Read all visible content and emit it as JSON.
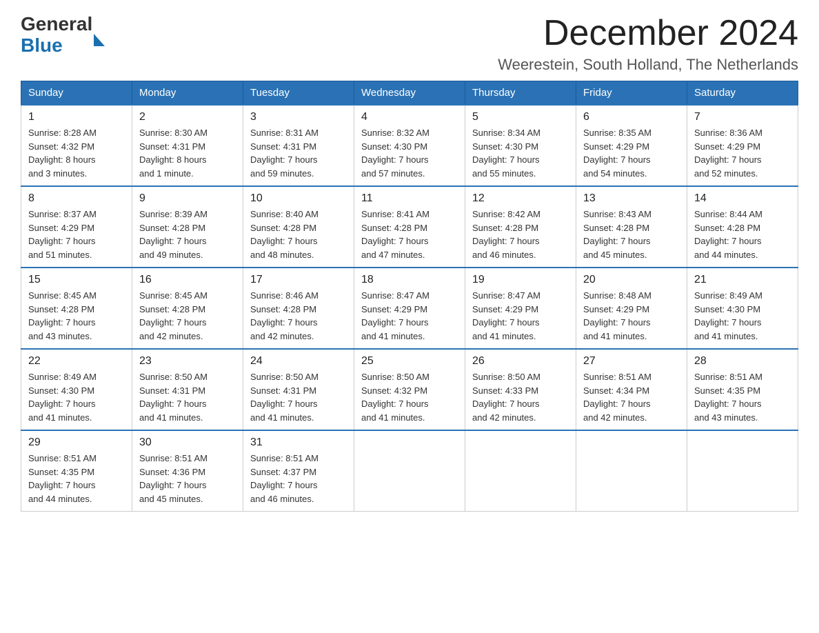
{
  "header": {
    "logo_general": "General",
    "logo_blue": "Blue",
    "month_title": "December 2024",
    "location": "Weerestein, South Holland, The Netherlands"
  },
  "weekdays": [
    "Sunday",
    "Monday",
    "Tuesday",
    "Wednesday",
    "Thursday",
    "Friday",
    "Saturday"
  ],
  "weeks": [
    [
      {
        "num": "1",
        "info": "Sunrise: 8:28 AM\nSunset: 4:32 PM\nDaylight: 8 hours\nand 3 minutes."
      },
      {
        "num": "2",
        "info": "Sunrise: 8:30 AM\nSunset: 4:31 PM\nDaylight: 8 hours\nand 1 minute."
      },
      {
        "num": "3",
        "info": "Sunrise: 8:31 AM\nSunset: 4:31 PM\nDaylight: 7 hours\nand 59 minutes."
      },
      {
        "num": "4",
        "info": "Sunrise: 8:32 AM\nSunset: 4:30 PM\nDaylight: 7 hours\nand 57 minutes."
      },
      {
        "num": "5",
        "info": "Sunrise: 8:34 AM\nSunset: 4:30 PM\nDaylight: 7 hours\nand 55 minutes."
      },
      {
        "num": "6",
        "info": "Sunrise: 8:35 AM\nSunset: 4:29 PM\nDaylight: 7 hours\nand 54 minutes."
      },
      {
        "num": "7",
        "info": "Sunrise: 8:36 AM\nSunset: 4:29 PM\nDaylight: 7 hours\nand 52 minutes."
      }
    ],
    [
      {
        "num": "8",
        "info": "Sunrise: 8:37 AM\nSunset: 4:29 PM\nDaylight: 7 hours\nand 51 minutes."
      },
      {
        "num": "9",
        "info": "Sunrise: 8:39 AM\nSunset: 4:28 PM\nDaylight: 7 hours\nand 49 minutes."
      },
      {
        "num": "10",
        "info": "Sunrise: 8:40 AM\nSunset: 4:28 PM\nDaylight: 7 hours\nand 48 minutes."
      },
      {
        "num": "11",
        "info": "Sunrise: 8:41 AM\nSunset: 4:28 PM\nDaylight: 7 hours\nand 47 minutes."
      },
      {
        "num": "12",
        "info": "Sunrise: 8:42 AM\nSunset: 4:28 PM\nDaylight: 7 hours\nand 46 minutes."
      },
      {
        "num": "13",
        "info": "Sunrise: 8:43 AM\nSunset: 4:28 PM\nDaylight: 7 hours\nand 45 minutes."
      },
      {
        "num": "14",
        "info": "Sunrise: 8:44 AM\nSunset: 4:28 PM\nDaylight: 7 hours\nand 44 minutes."
      }
    ],
    [
      {
        "num": "15",
        "info": "Sunrise: 8:45 AM\nSunset: 4:28 PM\nDaylight: 7 hours\nand 43 minutes."
      },
      {
        "num": "16",
        "info": "Sunrise: 8:45 AM\nSunset: 4:28 PM\nDaylight: 7 hours\nand 42 minutes."
      },
      {
        "num": "17",
        "info": "Sunrise: 8:46 AM\nSunset: 4:28 PM\nDaylight: 7 hours\nand 42 minutes."
      },
      {
        "num": "18",
        "info": "Sunrise: 8:47 AM\nSunset: 4:29 PM\nDaylight: 7 hours\nand 41 minutes."
      },
      {
        "num": "19",
        "info": "Sunrise: 8:47 AM\nSunset: 4:29 PM\nDaylight: 7 hours\nand 41 minutes."
      },
      {
        "num": "20",
        "info": "Sunrise: 8:48 AM\nSunset: 4:29 PM\nDaylight: 7 hours\nand 41 minutes."
      },
      {
        "num": "21",
        "info": "Sunrise: 8:49 AM\nSunset: 4:30 PM\nDaylight: 7 hours\nand 41 minutes."
      }
    ],
    [
      {
        "num": "22",
        "info": "Sunrise: 8:49 AM\nSunset: 4:30 PM\nDaylight: 7 hours\nand 41 minutes."
      },
      {
        "num": "23",
        "info": "Sunrise: 8:50 AM\nSunset: 4:31 PM\nDaylight: 7 hours\nand 41 minutes."
      },
      {
        "num": "24",
        "info": "Sunrise: 8:50 AM\nSunset: 4:31 PM\nDaylight: 7 hours\nand 41 minutes."
      },
      {
        "num": "25",
        "info": "Sunrise: 8:50 AM\nSunset: 4:32 PM\nDaylight: 7 hours\nand 41 minutes."
      },
      {
        "num": "26",
        "info": "Sunrise: 8:50 AM\nSunset: 4:33 PM\nDaylight: 7 hours\nand 42 minutes."
      },
      {
        "num": "27",
        "info": "Sunrise: 8:51 AM\nSunset: 4:34 PM\nDaylight: 7 hours\nand 42 minutes."
      },
      {
        "num": "28",
        "info": "Sunrise: 8:51 AM\nSunset: 4:35 PM\nDaylight: 7 hours\nand 43 minutes."
      }
    ],
    [
      {
        "num": "29",
        "info": "Sunrise: 8:51 AM\nSunset: 4:35 PM\nDaylight: 7 hours\nand 44 minutes."
      },
      {
        "num": "30",
        "info": "Sunrise: 8:51 AM\nSunset: 4:36 PM\nDaylight: 7 hours\nand 45 minutes."
      },
      {
        "num": "31",
        "info": "Sunrise: 8:51 AM\nSunset: 4:37 PM\nDaylight: 7 hours\nand 46 minutes."
      },
      null,
      null,
      null,
      null
    ]
  ]
}
